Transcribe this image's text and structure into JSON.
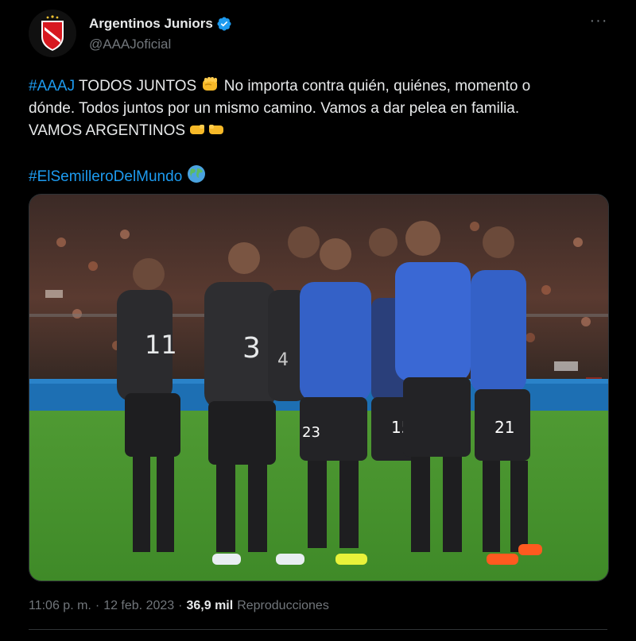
{
  "tweet": {
    "display_name": "Argentinos Juniors",
    "handle": "@AAAJoficial",
    "verified_color": "#1d9bf0",
    "line1_hashtag": "#AAAJ",
    "line1_text": " TODOS JUNTOS ",
    "line1_after": " No importa contra quién, quiénes, momento o",
    "line2_text": "dónde. Todos juntos por un mismo camino. Vamos a dar pelea en familia.",
    "line3_text": "VAMOS ARGENTINOS ",
    "hashtag2": "#ElSemilleroDelMundo",
    "time": "11:06 p. m.",
    "separator": "·",
    "date": "12 feb. 2023",
    "views_count": "36,9 mil",
    "views_label": "Reproducciones",
    "icons": [
      "logo-icon",
      "verified-icon",
      "more-icon",
      "fist-icon",
      "fist-bump-icon",
      "globe-icon"
    ],
    "colors": {
      "link": "#1d9bf0",
      "text": "#e7e9ea",
      "muted": "#71767b",
      "background": "#000000"
    }
  },
  "photo": {
    "jersey_numbers": [
      "11",
      "3",
      "4",
      "15",
      "21",
      "23"
    ]
  }
}
